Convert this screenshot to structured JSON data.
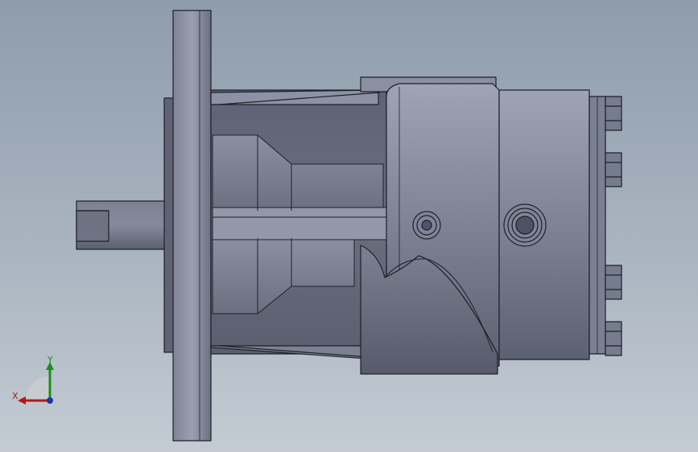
{
  "viewport": {
    "background_top": "#8e9cac",
    "background_bottom": "#c4cbd3",
    "part_color": "#6f7486",
    "edge_color": "#1e2028"
  },
  "model": {
    "icon": "hydraulic-motor-model"
  },
  "triad": {
    "x_label": "X",
    "y_label": "Y",
    "x_color": "#b01818",
    "y_color": "#1a8f1a",
    "z_color": "#2233aa"
  }
}
